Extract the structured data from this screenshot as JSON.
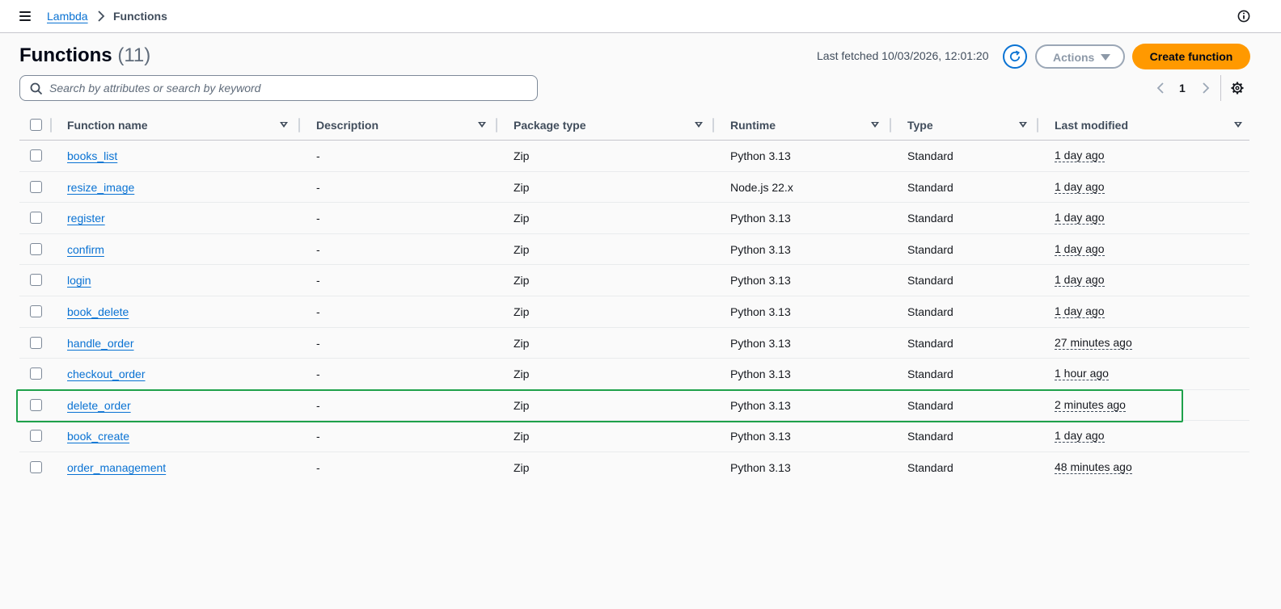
{
  "breadcrumb": {
    "root": "Lambda",
    "current": "Functions"
  },
  "header": {
    "title": "Functions",
    "count": "(11)",
    "last_fetched": "Last fetched 10/03/2026, 12:01:20",
    "actions_label": "Actions",
    "create_label": "Create function"
  },
  "search": {
    "placeholder": "Search by attributes or search by keyword"
  },
  "pagination": {
    "current_page": "1"
  },
  "table": {
    "columns": [
      "Function name",
      "Description",
      "Package type",
      "Runtime",
      "Type",
      "Last modified"
    ],
    "rows": [
      {
        "name": "books_list",
        "description": "-",
        "package": "Zip",
        "runtime": "Python 3.13",
        "type": "Standard",
        "modified": "1 day ago"
      },
      {
        "name": "resize_image",
        "description": "-",
        "package": "Zip",
        "runtime": "Node.js 22.x",
        "type": "Standard",
        "modified": "1 day ago"
      },
      {
        "name": "register",
        "description": "-",
        "package": "Zip",
        "runtime": "Python 3.13",
        "type": "Standard",
        "modified": "1 day ago"
      },
      {
        "name": "confirm",
        "description": "-",
        "package": "Zip",
        "runtime": "Python 3.13",
        "type": "Standard",
        "modified": "1 day ago"
      },
      {
        "name": "login",
        "description": "-",
        "package": "Zip",
        "runtime": "Python 3.13",
        "type": "Standard",
        "modified": "1 day ago"
      },
      {
        "name": "book_delete",
        "description": "-",
        "package": "Zip",
        "runtime": "Python 3.13",
        "type": "Standard",
        "modified": "1 day ago"
      },
      {
        "name": "handle_order",
        "description": "-",
        "package": "Zip",
        "runtime": "Python 3.13",
        "type": "Standard",
        "modified": "27 minutes ago"
      },
      {
        "name": "checkout_order",
        "description": "-",
        "package": "Zip",
        "runtime": "Python 3.13",
        "type": "Standard",
        "modified": "1 hour ago"
      },
      {
        "name": "delete_order",
        "description": "-",
        "package": "Zip",
        "runtime": "Python 3.13",
        "type": "Standard",
        "modified": "2 minutes ago"
      },
      {
        "name": "book_create",
        "description": "-",
        "package": "Zip",
        "runtime": "Python 3.13",
        "type": "Standard",
        "modified": "1 day ago"
      },
      {
        "name": "order_management",
        "description": "-",
        "package": "Zip",
        "runtime": "Python 3.13",
        "type": "Standard",
        "modified": "48 minutes ago"
      }
    ]
  },
  "highlight": {
    "row": "delete_order",
    "color": "#1ea14a"
  },
  "colors": {
    "link": "#0972d3",
    "primary_button": "#ff9900",
    "text": "#16191f"
  },
  "icons": [
    "menu-icon",
    "chevron-right-icon",
    "info-icon",
    "refresh-icon",
    "caret-down-icon",
    "search-icon",
    "chevron-left-icon",
    "gear-icon",
    "sort-icon"
  ]
}
